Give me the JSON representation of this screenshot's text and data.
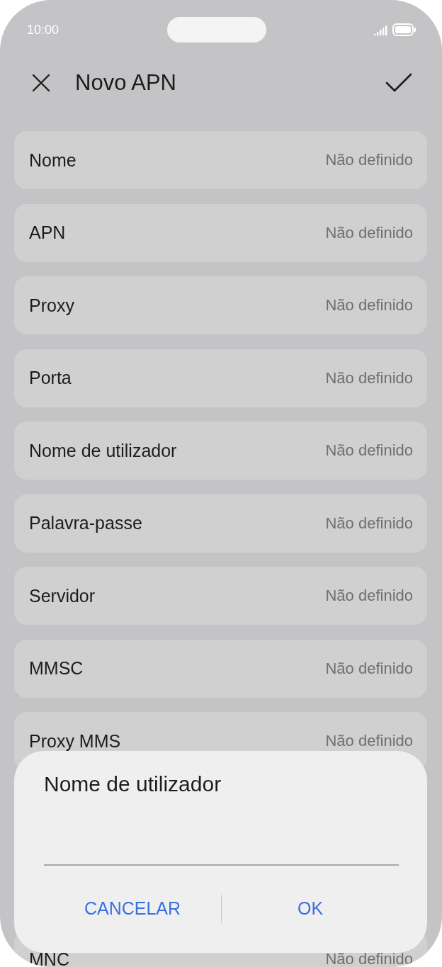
{
  "status_bar": {
    "time": "10:00"
  },
  "header": {
    "title": "Novo APN"
  },
  "settings": [
    {
      "label": "Nome",
      "value": "Não definido"
    },
    {
      "label": "APN",
      "value": "Não definido"
    },
    {
      "label": "Proxy",
      "value": "Não definido"
    },
    {
      "label": "Porta",
      "value": "Não definido"
    },
    {
      "label": "Nome de utilizador",
      "value": "Não definido"
    },
    {
      "label": "Palavra-passe",
      "value": "Não definido"
    },
    {
      "label": "Servidor",
      "value": "Não definido"
    },
    {
      "label": "MMSC",
      "value": "Não definido"
    },
    {
      "label": "Proxy MMS",
      "value": "Não definido"
    }
  ],
  "bottom_row": {
    "label": "MNC",
    "value": "Não definido"
  },
  "dialog": {
    "title": "Nome de utilizador",
    "buttons": [
      "CANCELAR",
      "OK"
    ]
  }
}
